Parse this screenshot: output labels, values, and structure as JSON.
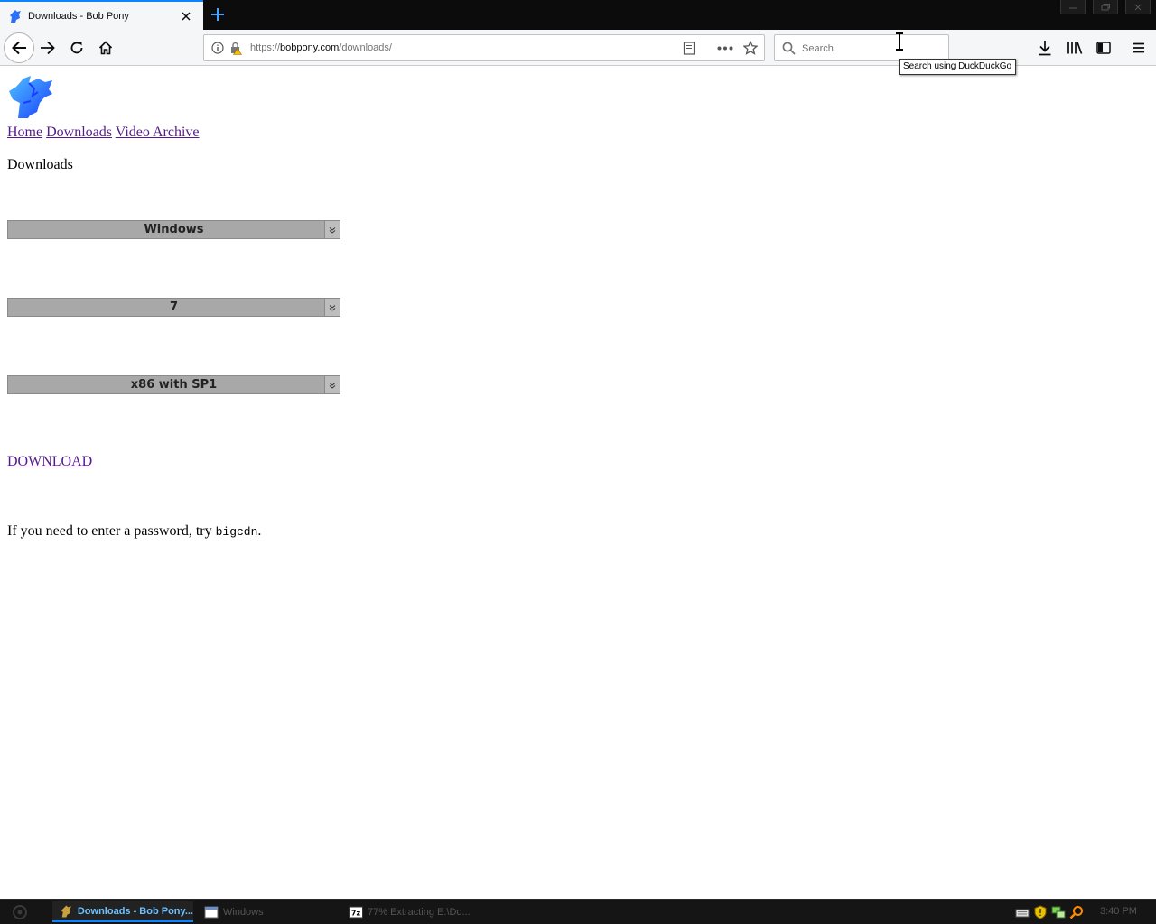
{
  "tab": {
    "title": "Downloads - Bob Pony"
  },
  "toolbar": {
    "url_prefix": "https://",
    "url_host": "bobpony.com",
    "url_path": "/downloads/",
    "search_placeholder": "Search",
    "tooltip": "Search using DuckDuckGo"
  },
  "page": {
    "nav": {
      "home": "Home",
      "downloads": "Downloads",
      "video_archive": "Video Archive"
    },
    "heading": "Downloads",
    "selects": {
      "os": "Windows",
      "version": "7",
      "edition": "x86 with SP1"
    },
    "download_link": "DOWNLOAD",
    "password_note_prefix": "If you need to enter a password, try ",
    "password_code": "bigcdn",
    "password_note_suffix": "."
  },
  "taskbar": {
    "tasks": {
      "browser": "Downloads - Bob Pony...",
      "explorer": "Windows",
      "sevenzip": "77% Extracting E:\\Do..."
    },
    "clock": "3:40 PM"
  },
  "colors": {
    "accent": "#0a84ff",
    "visited_link": "#551a8b",
    "select_bg": "#a8a8a8"
  },
  "icons": [
    "pony-logo-icon",
    "back-arrow-icon",
    "forward-arrow-icon",
    "reload-icon",
    "home-icon",
    "info-icon",
    "insecure-lock-icon",
    "reader-view-icon",
    "more-actions-icon",
    "bookmark-star-icon",
    "search-icon",
    "downloads-arrow-icon",
    "library-icon",
    "sidebar-icon",
    "hamburger-menu-icon"
  ]
}
